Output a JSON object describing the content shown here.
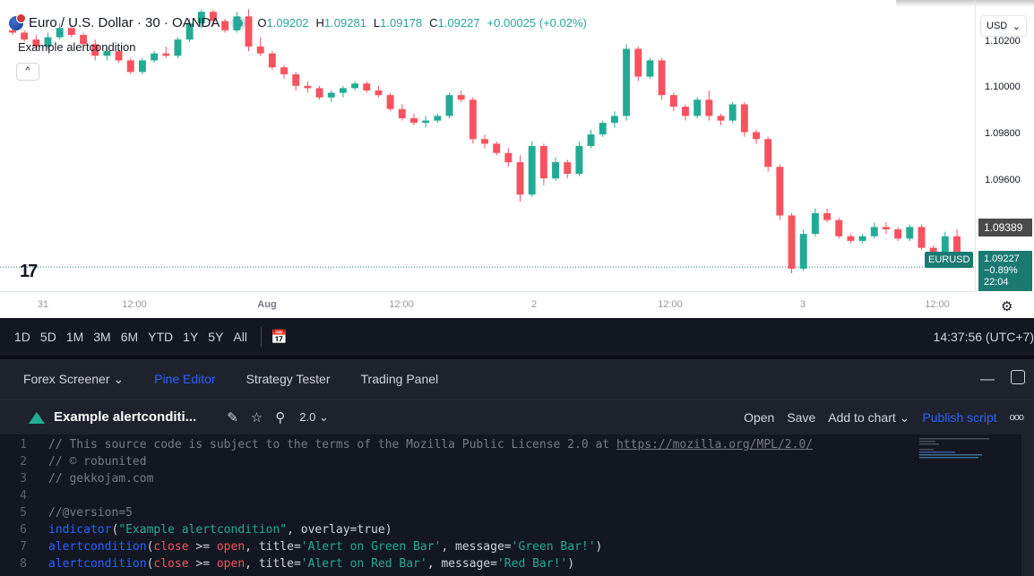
{
  "header": {
    "symbol_title": "Euro / U.S. Dollar · 30 · OANDA",
    "ohlc": {
      "o_label": "O",
      "o": "1.09202",
      "h_label": "H",
      "h": "1.09281",
      "l_label": "L",
      "l": "1.09178",
      "c_label": "C",
      "c": "1.09227",
      "change": "+0.00025 (+0.02%)"
    },
    "indicator_name": "Example alertcondition",
    "collapse_glyph": "^",
    "currency": "USD",
    "logo_text": "17"
  },
  "price_axis": {
    "ticks": [
      "1.10200",
      "1.10000",
      "1.09800",
      "1.09600"
    ],
    "last_price_tag": "1.09389",
    "symbol_tag": "EURUSD",
    "current_price": "1.09227",
    "current_change": "−0.89%",
    "countdown": "22:04"
  },
  "time_axis": {
    "ticks": [
      {
        "label": "31",
        "bold": false
      },
      {
        "label": "12:00",
        "bold": false
      },
      {
        "label": "Aug",
        "bold": true
      },
      {
        "label": "12:00",
        "bold": false
      },
      {
        "label": "2",
        "bold": false
      },
      {
        "label": "12:00",
        "bold": false
      },
      {
        "label": "3",
        "bold": false
      },
      {
        "label": "12:00",
        "bold": false
      }
    ]
  },
  "chart_data": {
    "type": "candlestick",
    "ylim": [
      1.0915,
      1.1035
    ],
    "up_color": "#22ab94",
    "down_color": "#f7525f",
    "candles": [
      [
        1.1025,
        1.1026,
        1.1023,
        1.1024
      ],
      [
        1.1024,
        1.1025,
        1.102,
        1.1021
      ],
      [
        1.1021,
        1.1023,
        1.1017,
        1.1018
      ],
      [
        1.1018,
        1.1024,
        1.1017,
        1.1022
      ],
      [
        1.1022,
        1.1028,
        1.1021,
        1.1026
      ],
      [
        1.1026,
        1.1027,
        1.1022,
        1.1023
      ],
      [
        1.1023,
        1.1024,
        1.1017,
        1.1019
      ],
      [
        1.1019,
        1.1021,
        1.1012,
        1.1014
      ],
      [
        1.1014,
        1.1018,
        1.1012,
        1.1016
      ],
      [
        1.1016,
        1.1017,
        1.1011,
        1.1012
      ],
      [
        1.1012,
        1.1013,
        1.1006,
        1.1007
      ],
      [
        1.1007,
        1.1013,
        1.1006,
        1.1012
      ],
      [
        1.1012,
        1.1016,
        1.1011,
        1.1015
      ],
      [
        1.1015,
        1.1018,
        1.1013,
        1.1014
      ],
      [
        1.1014,
        1.1022,
        1.1013,
        1.1021
      ],
      [
        1.1021,
        1.103,
        1.102,
        1.1028
      ],
      [
        1.1028,
        1.1034,
        1.1026,
        1.1033
      ],
      [
        1.1033,
        1.1034,
        1.1027,
        1.1029
      ],
      [
        1.1029,
        1.103,
        1.1024,
        1.1025
      ],
      [
        1.1025,
        1.1033,
        1.1024,
        1.1031
      ],
      [
        1.1031,
        1.1034,
        1.1016,
        1.1018
      ],
      [
        1.1018,
        1.1022,
        1.1014,
        1.1015
      ],
      [
        1.1015,
        1.1016,
        1.1008,
        1.1009
      ],
      [
        1.1009,
        1.101,
        1.1004,
        1.1006
      ],
      [
        1.1006,
        1.1007,
        1.0999,
        1.1001
      ],
      [
        1.1001,
        1.1003,
        1.0998,
        1.1
      ],
      [
        1.1,
        1.1001,
        1.0995,
        1.0996
      ],
      [
        1.0996,
        1.0999,
        1.0994,
        1.0998
      ],
      [
        1.0998,
        1.1001,
        1.0996,
        1.1
      ],
      [
        1.1,
        1.1003,
        1.0999,
        1.1002
      ],
      [
        1.1002,
        1.1003,
        1.0998,
        1.0999
      ],
      [
        1.0999,
        1.1001,
        1.0996,
        1.0997
      ],
      [
        1.0997,
        1.0998,
        1.099,
        1.0991
      ],
      [
        1.0991,
        1.0993,
        1.0986,
        1.0987
      ],
      [
        1.0987,
        1.0989,
        1.0984,
        1.0985
      ],
      [
        1.0985,
        1.0988,
        1.0983,
        1.0986
      ],
      [
        1.0986,
        1.0989,
        1.0985,
        1.0988
      ],
      [
        1.0988,
        1.0998,
        1.0987,
        1.0997
      ],
      [
        1.0997,
        1.0999,
        1.0994,
        1.0995
      ],
      [
        1.0995,
        1.0996,
        1.0976,
        1.0978
      ],
      [
        1.0978,
        1.098,
        1.0974,
        1.0976
      ],
      [
        1.0976,
        1.0977,
        1.0971,
        1.0972
      ],
      [
        1.0972,
        1.0974,
        1.0966,
        1.0968
      ],
      [
        1.0968,
        1.0971,
        1.0951,
        1.0954
      ],
      [
        1.0954,
        1.0977,
        1.0953,
        1.0975
      ],
      [
        1.0975,
        1.0976,
        1.0958,
        1.0961
      ],
      [
        1.0961,
        1.097,
        1.096,
        1.0968
      ],
      [
        1.0968,
        1.0969,
        1.0961,
        1.0963
      ],
      [
        1.0963,
        1.0977,
        1.0962,
        1.0975
      ],
      [
        1.0975,
        1.0982,
        1.0974,
        1.098
      ],
      [
        1.098,
        1.0986,
        1.0979,
        1.0985
      ],
      [
        1.0985,
        1.099,
        1.0983,
        1.0988
      ],
      [
        1.0988,
        1.1019,
        1.0986,
        1.1017
      ],
      [
        1.1017,
        1.1018,
        1.1003,
        1.1005
      ],
      [
        1.1005,
        1.1013,
        1.1004,
        1.1012
      ],
      [
        1.1012,
        1.1013,
        1.0995,
        1.0997
      ],
      [
        1.0997,
        1.0998,
        1.099,
        1.0992
      ],
      [
        1.0992,
        1.0993,
        1.0986,
        1.0988
      ],
      [
        1.0988,
        1.0996,
        1.0987,
        1.0995
      ],
      [
        1.0995,
        1.0999,
        1.0986,
        1.0988
      ],
      [
        1.0988,
        1.0989,
        1.0984,
        1.0986
      ],
      [
        1.0986,
        1.0994,
        1.0985,
        1.0993
      ],
      [
        1.0993,
        1.0994,
        1.0979,
        1.0981
      ],
      [
        1.0981,
        1.0982,
        1.0976,
        1.0978
      ],
      [
        1.0978,
        1.0979,
        1.0964,
        1.0966
      ],
      [
        1.0966,
        1.0967,
        1.0943,
        1.0945
      ],
      [
        1.0945,
        1.0946,
        1.092,
        1.0922
      ],
      [
        1.0922,
        1.0939,
        1.0921,
        1.0937
      ],
      [
        1.0937,
        1.0948,
        1.0936,
        1.0946
      ],
      [
        1.0946,
        1.0948,
        1.0942,
        1.0943
      ],
      [
        1.0943,
        1.0944,
        1.0935,
        1.0936
      ],
      [
        1.0936,
        1.0937,
        1.0933,
        1.0934
      ],
      [
        1.0934,
        1.0937,
        1.0933,
        1.0936
      ],
      [
        1.0936,
        1.0942,
        1.0935,
        1.094
      ],
      [
        1.094,
        1.0942,
        1.0937,
        1.0939
      ],
      [
        1.0939,
        1.094,
        1.0934,
        1.0935
      ],
      [
        1.0935,
        1.0941,
        1.0934,
        1.094
      ],
      [
        1.094,
        1.0941,
        1.093,
        1.0931
      ],
      [
        1.0931,
        1.0932,
        1.0926,
        1.0927
      ],
      [
        1.0927,
        1.0938,
        1.0926,
        1.0936
      ],
      [
        1.0936,
        1.0939,
        1.0924,
        1.0925
      ]
    ]
  },
  "period_bar": {
    "periods": [
      "1D",
      "5D",
      "1M",
      "3M",
      "6M",
      "YTD",
      "1Y",
      "5Y",
      "All"
    ],
    "clock": "14:37:56 (UTC+7)"
  },
  "panel_tabs": [
    {
      "label": "Forex Screener",
      "has_chevron": true,
      "active": false
    },
    {
      "label": "Pine Editor",
      "has_chevron": false,
      "active": true
    },
    {
      "label": "Strategy Tester",
      "has_chevron": false,
      "active": false
    },
    {
      "label": "Trading Panel",
      "has_chevron": false,
      "active": false
    }
  ],
  "editor_toolbar": {
    "script_title": "Example alertconditi...",
    "version": "2.0",
    "open_label": "Open",
    "save_label": "Save",
    "add_to_chart_label": "Add to chart",
    "publish_label": "Publish script",
    "more_glyph": "ooo"
  },
  "code": {
    "lines": [
      {
        "n": "1",
        "parts": [
          {
            "c": "cm",
            "t": "// This source code is subject to the terms of the Mozilla Public License 2.0 at "
          },
          {
            "c": "url",
            "t": "https://mozilla.org/MPL/2.0/"
          }
        ]
      },
      {
        "n": "2",
        "parts": [
          {
            "c": "cm",
            "t": "// © robunited"
          }
        ]
      },
      {
        "n": "3",
        "parts": [
          {
            "c": "cm",
            "t": "// gekkojam.com"
          }
        ]
      },
      {
        "n": "4",
        "parts": []
      },
      {
        "n": "5",
        "parts": [
          {
            "c": "cm",
            "t": "//@version=5"
          }
        ]
      },
      {
        "n": "6",
        "parts": [
          {
            "c": "fn",
            "t": "indicator"
          },
          {
            "c": "txt",
            "t": "("
          },
          {
            "c": "str",
            "t": "\"Example alertcondition\""
          },
          {
            "c": "txt",
            "t": ", overlay=true)"
          }
        ]
      },
      {
        "n": "7",
        "parts": [
          {
            "c": "fn",
            "t": "alertcondition"
          },
          {
            "c": "txt",
            "t": "("
          },
          {
            "c": "kw",
            "t": "close"
          },
          {
            "c": "txt",
            "t": " >= "
          },
          {
            "c": "kw",
            "t": "open"
          },
          {
            "c": "txt",
            "t": ", title="
          },
          {
            "c": "str",
            "t": "'Alert on Green Bar'"
          },
          {
            "c": "txt",
            "t": ", message="
          },
          {
            "c": "str",
            "t": "'Green Bar!'"
          },
          {
            "c": "txt",
            "t": ")"
          }
        ]
      },
      {
        "n": "8",
        "parts": [
          {
            "c": "fn",
            "t": "alertcondition"
          },
          {
            "c": "txt",
            "t": "("
          },
          {
            "c": "kw",
            "t": "close"
          },
          {
            "c": "txt",
            "t": " >= "
          },
          {
            "c": "kw",
            "t": "open"
          },
          {
            "c": "txt",
            "t": ", title="
          },
          {
            "c": "str",
            "t": "'Alert on Red Bar'"
          },
          {
            "c": "txt",
            "t": ", message="
          },
          {
            "c": "str",
            "t": "'Red Bar!'"
          },
          {
            "c": "txt",
            "t": ")"
          }
        ]
      }
    ]
  }
}
